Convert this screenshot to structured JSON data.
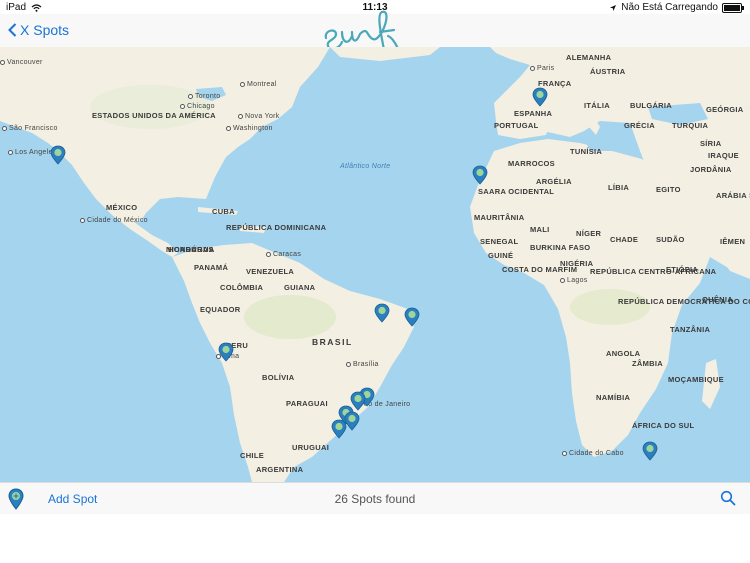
{
  "status": {
    "device": "iPad",
    "time": "11:13",
    "charging": "Não Está Carregando"
  },
  "nav": {
    "back_label": "X Spots",
    "logo_text": "surf"
  },
  "map": {
    "labels": [
      {
        "text": "ESTADOS UNIDOS DA AMÉRICA",
        "type": "country"
      },
      {
        "text": "MÉXICO",
        "type": "country"
      },
      {
        "text": "CUBA",
        "type": "country"
      },
      {
        "text": "REPÚBLICA DOMINICANA",
        "type": "country"
      },
      {
        "text": "HONDURAS",
        "type": "country"
      },
      {
        "text": "NICARÁGUA",
        "type": "country"
      },
      {
        "text": "PANAMÁ",
        "type": "country"
      },
      {
        "text": "VENEZUELA",
        "type": "country"
      },
      {
        "text": "COLÔMBIA",
        "type": "country"
      },
      {
        "text": "GUIANA",
        "type": "country"
      },
      {
        "text": "EQUADOR",
        "type": "country"
      },
      {
        "text": "PERU",
        "type": "country"
      },
      {
        "text": "BRASIL",
        "type": "country"
      },
      {
        "text": "BOLÍVIA",
        "type": "country"
      },
      {
        "text": "PARAGUAI",
        "type": "country"
      },
      {
        "text": "CHILE",
        "type": "country"
      },
      {
        "text": "URUGUAI",
        "type": "country"
      },
      {
        "text": "ARGENTINA",
        "type": "country"
      },
      {
        "text": "ALEMANHA",
        "type": "country"
      },
      {
        "text": "ÁUSTRIA",
        "type": "country"
      },
      {
        "text": "FRANÇA",
        "type": "country"
      },
      {
        "text": "ESPANHA",
        "type": "country"
      },
      {
        "text": "PORTUGAL",
        "type": "country"
      },
      {
        "text": "ITÁLIA",
        "type": "country"
      },
      {
        "text": "BULGÁRIA",
        "type": "country"
      },
      {
        "text": "GRÉCIA",
        "type": "country"
      },
      {
        "text": "TURQUIA",
        "type": "country"
      },
      {
        "text": "GEÓRGIA",
        "type": "country"
      },
      {
        "text": "SÍRIA",
        "type": "country"
      },
      {
        "text": "IRAQUE",
        "type": "country"
      },
      {
        "text": "JORDÂNIA",
        "type": "country"
      },
      {
        "text": "TUNÍSIA",
        "type": "country"
      },
      {
        "text": "MARROCOS",
        "type": "country"
      },
      {
        "text": "ARGÉLIA",
        "type": "country"
      },
      {
        "text": "LÍBIA",
        "type": "country"
      },
      {
        "text": "EGITO",
        "type": "country"
      },
      {
        "text": "SAARA OCIDENTAL",
        "type": "country"
      },
      {
        "text": "MAURITÂNIA",
        "type": "country"
      },
      {
        "text": "MALI",
        "type": "country"
      },
      {
        "text": "NÍGER",
        "type": "country"
      },
      {
        "text": "CHADE",
        "type": "country"
      },
      {
        "text": "SUDÃO",
        "type": "country"
      },
      {
        "text": "SENEGAL",
        "type": "country"
      },
      {
        "text": "GUINÉ",
        "type": "country"
      },
      {
        "text": "BURKINA FASO",
        "type": "country"
      },
      {
        "text": "COSTA DO MARFIM",
        "type": "country"
      },
      {
        "text": "NIGÉRIA",
        "type": "country"
      },
      {
        "text": "REPÚBLICA CENTRO-AFRICANA",
        "type": "country"
      },
      {
        "text": "ETIÓPIA",
        "type": "country"
      },
      {
        "text": "ARÁBIA SAUDITA",
        "type": "country"
      },
      {
        "text": "IÊMEN",
        "type": "country"
      },
      {
        "text": "QUÊNIA",
        "type": "country"
      },
      {
        "text": "REPÚBLICA DEMOCRÁTICA DO CONGO",
        "type": "country"
      },
      {
        "text": "TANZÂNIA",
        "type": "country"
      },
      {
        "text": "ANGOLA",
        "type": "country"
      },
      {
        "text": "ZÂMBIA",
        "type": "country"
      },
      {
        "text": "MOÇAMBIQUE",
        "type": "country"
      },
      {
        "text": "NAMÍBIA",
        "type": "country"
      },
      {
        "text": "ÁFRICA DO SUL",
        "type": "country"
      },
      {
        "text": "Vancouver",
        "type": "city"
      },
      {
        "text": "Montreal",
        "type": "city"
      },
      {
        "text": "Toronto",
        "type": "city"
      },
      {
        "text": "Chicago",
        "type": "city"
      },
      {
        "text": "Nova York",
        "type": "city"
      },
      {
        "text": "Washington",
        "type": "city"
      },
      {
        "text": "São Francisco",
        "type": "city"
      },
      {
        "text": "Los Angeles",
        "type": "city"
      },
      {
        "text": "Cidade do México",
        "type": "city"
      },
      {
        "text": "Caracas",
        "type": "city"
      },
      {
        "text": "Lima",
        "type": "city"
      },
      {
        "text": "Brasília",
        "type": "city"
      },
      {
        "text": "Rio de Janeiro",
        "type": "city"
      },
      {
        "text": "Paris",
        "type": "city"
      },
      {
        "text": "Lagos",
        "type": "city"
      },
      {
        "text": "Cidade do Cabo",
        "type": "city"
      },
      {
        "text": "Atlântico Norte",
        "type": "sea"
      }
    ]
  },
  "bottom": {
    "add_label": "Add Spot",
    "count_label": "26 Spots found"
  },
  "colors": {
    "water": "#a5d4ee",
    "land": "#f3efe2",
    "accent": "#1a73d6",
    "pin": "#2a7fbf",
    "pin_dot": "#9fd59a",
    "logo": "#4aa8b8"
  },
  "icons": [
    "wifi-icon",
    "location-arrow-icon",
    "battery-icon",
    "chevron-left-icon",
    "map-pin-icon",
    "add-spot-pin-icon",
    "search-icon"
  ]
}
